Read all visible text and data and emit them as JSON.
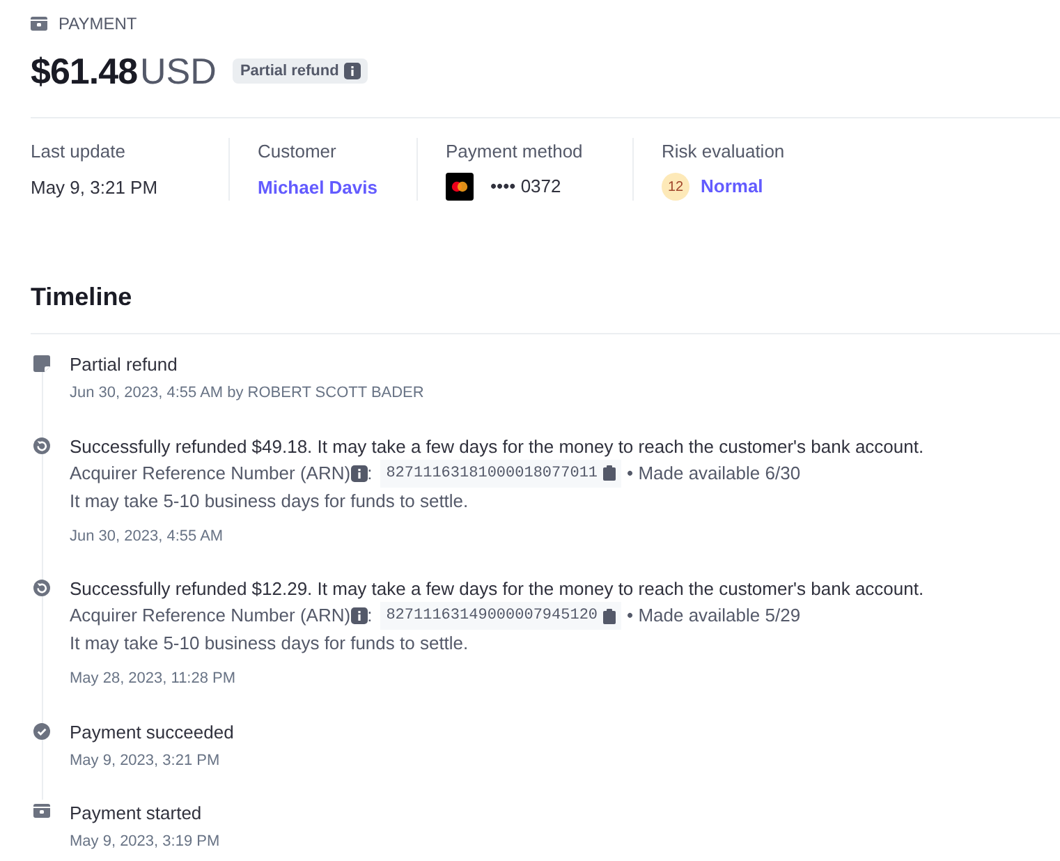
{
  "header": {
    "label": "PAYMENT",
    "amount": "$61.48",
    "currency": "USD",
    "badge": "Partial refund"
  },
  "summary": [
    {
      "kind": "text",
      "label": "Last update",
      "value": "May 9, 3:21 PM"
    },
    {
      "kind": "link",
      "label": "Customer",
      "value": "Michael Davis"
    },
    {
      "kind": "card",
      "label": "Payment method",
      "value": "•••• 0372"
    },
    {
      "kind": "risk",
      "label": "Risk evaluation",
      "score": "12",
      "value": "Normal"
    }
  ],
  "timeline": {
    "title": "Timeline",
    "events": [
      {
        "kind": "note",
        "title": "Partial refund",
        "time": "Jun 30, 2023, 4:55 AM by ROBERT SCOTT BADER"
      },
      {
        "kind": "refund",
        "title": "Successfully refunded $49.18. It may take a few days for the money to reach the customer's bank account.",
        "arn_label": "Acquirer Reference Number (ARN)",
        "separator": ":",
        "arn": "82711163181000018077011",
        "available": "• Made available 6/30",
        "note": "It may take 5-10 business days for funds to settle.",
        "time": "Jun 30, 2023, 4:55 AM"
      },
      {
        "kind": "refund",
        "title": "Successfully refunded $12.29. It may take a few days for the money to reach the customer's bank account.",
        "arn_label": "Acquirer Reference Number (ARN)",
        "separator": ":",
        "arn": "82711163149000007945120",
        "available": "• Made available 5/29",
        "note": "It may take 5-10 business days for funds to settle.",
        "time": "May 28, 2023, 11:28 PM"
      },
      {
        "kind": "succeeded",
        "title": "Payment succeeded",
        "time": "May 9, 2023, 3:21 PM"
      },
      {
        "kind": "started",
        "title": "Payment started",
        "time": "May 9, 2023, 3:19 PM"
      }
    ]
  }
}
